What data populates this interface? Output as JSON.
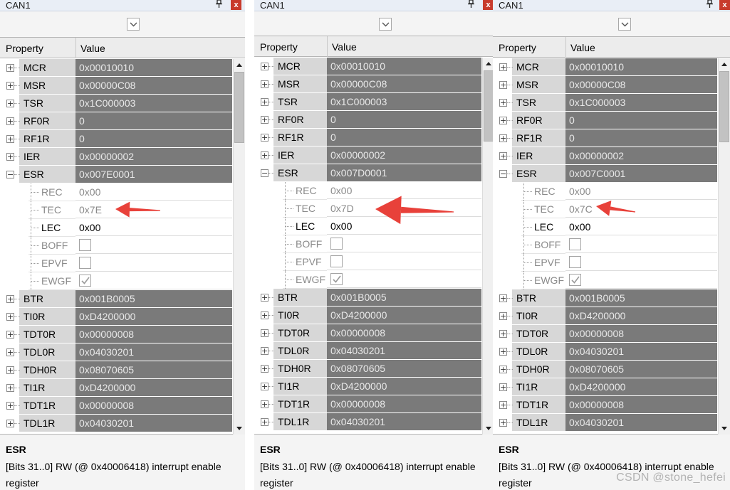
{
  "panels": [
    {
      "title": "CAN1",
      "pin_icon": "pin-icon",
      "close_label": "x",
      "header": {
        "property": "Property",
        "value": "Value"
      },
      "top_rows_before": [
        {
          "name": "MCR",
          "value": "0x00010010"
        },
        {
          "name": "MSR",
          "value": "0x00000C08"
        },
        {
          "name": "TSR",
          "value": "0x1C000003"
        },
        {
          "name": "RF0R",
          "value": "0"
        },
        {
          "name": "RF1R",
          "value": "0"
        },
        {
          "name": "IER",
          "value": "0x00000002"
        },
        {
          "name": "ESR",
          "value": "0x007E0001",
          "expanded": true
        }
      ],
      "esr_fields": [
        {
          "name": "REC",
          "value": "0x00",
          "type": "text",
          "dark": false
        },
        {
          "name": "TEC",
          "value": "0x7E",
          "type": "text",
          "dark": false
        },
        {
          "name": "LEC",
          "value": "0x00",
          "type": "text",
          "dark": true
        },
        {
          "name": "BOFF",
          "type": "checkbox",
          "checked": false
        },
        {
          "name": "EPVF",
          "type": "checkbox",
          "checked": false
        },
        {
          "name": "EWGF",
          "type": "checkbox",
          "checked": true
        }
      ],
      "top_rows_after": [
        {
          "name": "BTR",
          "value": "0x001B0005"
        },
        {
          "name": "TI0R",
          "value": "0xD4200000"
        },
        {
          "name": "TDT0R",
          "value": "0x00000008"
        },
        {
          "name": "TDL0R",
          "value": "0x04030201"
        },
        {
          "name": "TDH0R",
          "value": "0x08070605"
        },
        {
          "name": "TI1R",
          "value": "0xD4200000"
        },
        {
          "name": "TDT1R",
          "value": "0x00000008"
        },
        {
          "name": "TDL1R",
          "value": "0x04030201"
        }
      ],
      "description": {
        "title": "ESR",
        "text": "[Bits 31..0] RW (@ 0x40006418) interrupt enable register"
      }
    },
    {
      "title": "CAN1",
      "pin_icon": "pin-icon",
      "close_label": "x",
      "header": {
        "property": "Property",
        "value": "Value"
      },
      "top_rows_before": [
        {
          "name": "MCR",
          "value": "0x00010010"
        },
        {
          "name": "MSR",
          "value": "0x00000C08"
        },
        {
          "name": "TSR",
          "value": "0x1C000003"
        },
        {
          "name": "RF0R",
          "value": "0"
        },
        {
          "name": "RF1R",
          "value": "0"
        },
        {
          "name": "IER",
          "value": "0x00000002"
        },
        {
          "name": "ESR",
          "value": "0x007D0001",
          "expanded": true
        }
      ],
      "esr_fields": [
        {
          "name": "REC",
          "value": "0x00",
          "type": "text",
          "dark": false
        },
        {
          "name": "TEC",
          "value": "0x7D",
          "type": "text",
          "dark": false
        },
        {
          "name": "LEC",
          "value": "0x00",
          "type": "text",
          "dark": true
        },
        {
          "name": "BOFF",
          "type": "checkbox",
          "checked": false
        },
        {
          "name": "EPVF",
          "type": "checkbox",
          "checked": false
        },
        {
          "name": "EWGF",
          "type": "checkbox",
          "checked": true
        }
      ],
      "top_rows_after": [
        {
          "name": "BTR",
          "value": "0x001B0005"
        },
        {
          "name": "TI0R",
          "value": "0xD4200000"
        },
        {
          "name": "TDT0R",
          "value": "0x00000008"
        },
        {
          "name": "TDL0R",
          "value": "0x04030201"
        },
        {
          "name": "TDH0R",
          "value": "0x08070605"
        },
        {
          "name": "TI1R",
          "value": "0xD4200000"
        },
        {
          "name": "TDT1R",
          "value": "0x00000008"
        },
        {
          "name": "TDL1R",
          "value": "0x04030201"
        }
      ],
      "description": {
        "title": "ESR",
        "text": "[Bits 31..0] RW (@ 0x40006418) interrupt enable register"
      }
    },
    {
      "title": "CAN1",
      "pin_icon": "pin-icon",
      "close_label": "x",
      "header": {
        "property": "Property",
        "value": "Value"
      },
      "top_rows_before": [
        {
          "name": "MCR",
          "value": "0x00010010"
        },
        {
          "name": "MSR",
          "value": "0x00000C08"
        },
        {
          "name": "TSR",
          "value": "0x1C000003"
        },
        {
          "name": "RF0R",
          "value": "0"
        },
        {
          "name": "RF1R",
          "value": "0"
        },
        {
          "name": "IER",
          "value": "0x00000002"
        },
        {
          "name": "ESR",
          "value": "0x007C0001",
          "expanded": true
        }
      ],
      "esr_fields": [
        {
          "name": "REC",
          "value": "0x00",
          "type": "text",
          "dark": false
        },
        {
          "name": "TEC",
          "value": "0x7C",
          "type": "text",
          "dark": false
        },
        {
          "name": "LEC",
          "value": "0x00",
          "type": "text",
          "dark": true
        },
        {
          "name": "BOFF",
          "type": "checkbox",
          "checked": false
        },
        {
          "name": "EPVF",
          "type": "checkbox",
          "checked": false
        },
        {
          "name": "EWGF",
          "type": "checkbox",
          "checked": true
        }
      ],
      "top_rows_after": [
        {
          "name": "BTR",
          "value": "0x001B0005"
        },
        {
          "name": "TI0R",
          "value": "0xD4200000"
        },
        {
          "name": "TDT0R",
          "value": "0x00000008"
        },
        {
          "name": "TDL0R",
          "value": "0x04030201"
        },
        {
          "name": "TDH0R",
          "value": "0x08070605"
        },
        {
          "name": "TI1R",
          "value": "0xD4200000"
        },
        {
          "name": "TDT1R",
          "value": "0x00000008"
        },
        {
          "name": "TDL1R",
          "value": "0x04030201"
        }
      ],
      "description": {
        "title": "ESR",
        "text": "[Bits 31..0] RW (@ 0x40006418) interrupt enable register"
      }
    }
  ],
  "colors": {
    "value_cell_bg": "#7a7a7a",
    "annotation_arrow": "#e8413a",
    "close_button": "#c83b2c"
  },
  "watermark": "CSDN @stone_hefei"
}
